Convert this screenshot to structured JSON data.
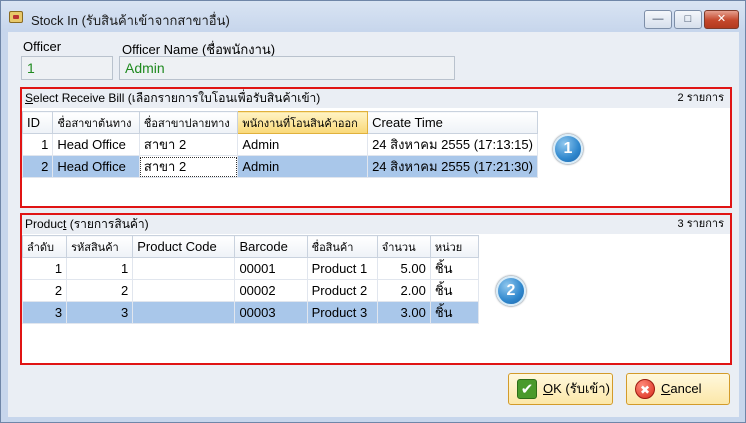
{
  "window": {
    "title": "Stock In (รับสินค้าเข้าจากสาขาอื่น)"
  },
  "officer": {
    "label": "Officer",
    "value": "1",
    "name_label": "Officer Name (ชื่อพนักงาน)",
    "name_value": "Admin"
  },
  "receive_bill": {
    "title_underlined": "S",
    "title_rest": "elect Receive Bill (เลือกรายการใบโอนเพื่อรับสินค้าเข้า)",
    "count": "2 รายการ",
    "marker": "1",
    "columns": [
      "ID",
      "ชื่อสาขาต้นทาง",
      "ชื่อสาขาปลายทาง",
      "พนักงานที่โอนสินค้าออก",
      "Create Time"
    ],
    "rows": [
      {
        "id": "1",
        "from": "Head Office",
        "to": "สาขา 2",
        "officer": "Admin",
        "time": "24 สิงหาคม 2555 (17:13:15)"
      },
      {
        "id": "2",
        "from": "Head Office",
        "to": "สาขา 2",
        "officer": "Admin",
        "time": "24 สิงหาคม 2555 (17:21:30)"
      }
    ]
  },
  "product": {
    "title_before": "Produc",
    "title_underlined": "t",
    "title_rest": " (รายการสินค้า)",
    "count": "3 รายการ",
    "marker": "2",
    "columns": [
      "ลำดับ",
      "รหัสสินค้า",
      "Product Code",
      "Barcode",
      "ชื่อสินค้า",
      "จำนวน",
      "หน่วย"
    ],
    "rows": [
      {
        "seq": "1",
        "code": "1",
        "pcode": "",
        "barcode": "00001",
        "name": "Product 1",
        "qty": "5.00",
        "unit": "ชิ้น"
      },
      {
        "seq": "2",
        "code": "2",
        "pcode": "",
        "barcode": "00002",
        "name": "Product 2",
        "qty": "2.00",
        "unit": "ชิ้น"
      },
      {
        "seq": "3",
        "code": "3",
        "pcode": "",
        "barcode": "00003",
        "name": "Product 3",
        "qty": "3.00",
        "unit": "ชิ้น"
      }
    ]
  },
  "buttons": {
    "ok_underlined": "O",
    "ok_rest": "K (รับเข้า)",
    "cancel_underlined": "C",
    "cancel_rest": "ancel"
  },
  "icons": {
    "app": "app-icon",
    "minimize": "minimize-icon",
    "maximize": "maximize-icon",
    "close": "close-icon",
    "ok": "checkmark-icon",
    "cancel": "cancel-x-icon"
  }
}
